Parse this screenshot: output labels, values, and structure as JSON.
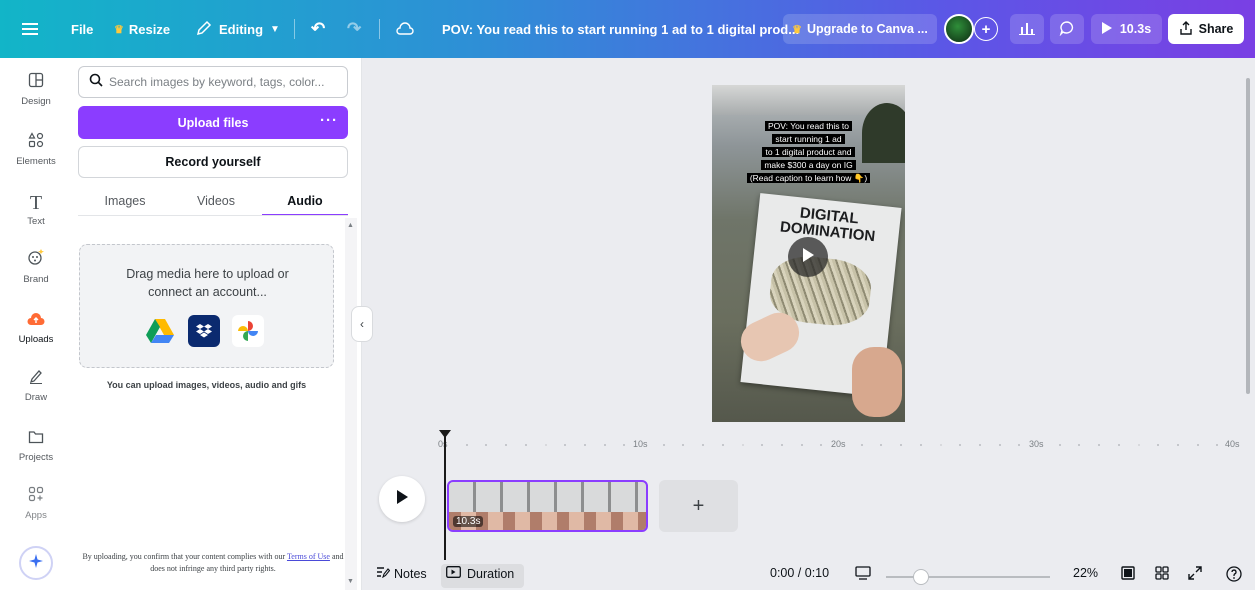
{
  "topbar": {
    "file_label": "File",
    "resize_label": "Resize",
    "editing_label": "Editing",
    "doc_title": "POV: You read this to start running 1 ad to 1 digital prod...",
    "upgrade_label": "Upgrade to Canva ...",
    "play_duration": "10.3s",
    "share_label": "Share"
  },
  "rail": {
    "items": [
      {
        "label": "Design"
      },
      {
        "label": "Elements"
      },
      {
        "label": "Text"
      },
      {
        "label": "Brand"
      },
      {
        "label": "Uploads"
      },
      {
        "label": "Draw"
      },
      {
        "label": "Projects"
      },
      {
        "label": "Apps"
      }
    ]
  },
  "panel": {
    "search_placeholder": "Search images by keyword, tags, color...",
    "upload_button": "Upload files",
    "upload_more": "···",
    "record_button": "Record yourself",
    "tabs": [
      {
        "label": "Images"
      },
      {
        "label": "Videos"
      },
      {
        "label": "Audio"
      }
    ],
    "dropzone_line1": "Drag media here to upload or",
    "dropzone_line2": "connect an account...",
    "hint": "You can upload images, videos, audio and gifs",
    "legal_prefix": "By uploading, you confirm that your content complies with our",
    "legal_link": "Terms of Use",
    "legal_suffix": "and does not infringe any third party rights."
  },
  "canvas": {
    "caption_lines": [
      "POV: You read this to",
      "start running 1 ad",
      "to 1 digital product and",
      "make $300 a day on IG",
      "(Read caption to learn how 👇)"
    ],
    "book_line1": "DIGITAL",
    "book_line2": "DOMINATION"
  },
  "timeline": {
    "ticks": [
      "0s",
      "10s",
      "20s",
      "30s",
      "40s"
    ],
    "clip_duration": "10.3s",
    "add_label": "+"
  },
  "bottombar": {
    "notes_label": "Notes",
    "duration_label": "Duration",
    "time_readout": "0:00 / 0:10",
    "zoom_level": "22%"
  }
}
